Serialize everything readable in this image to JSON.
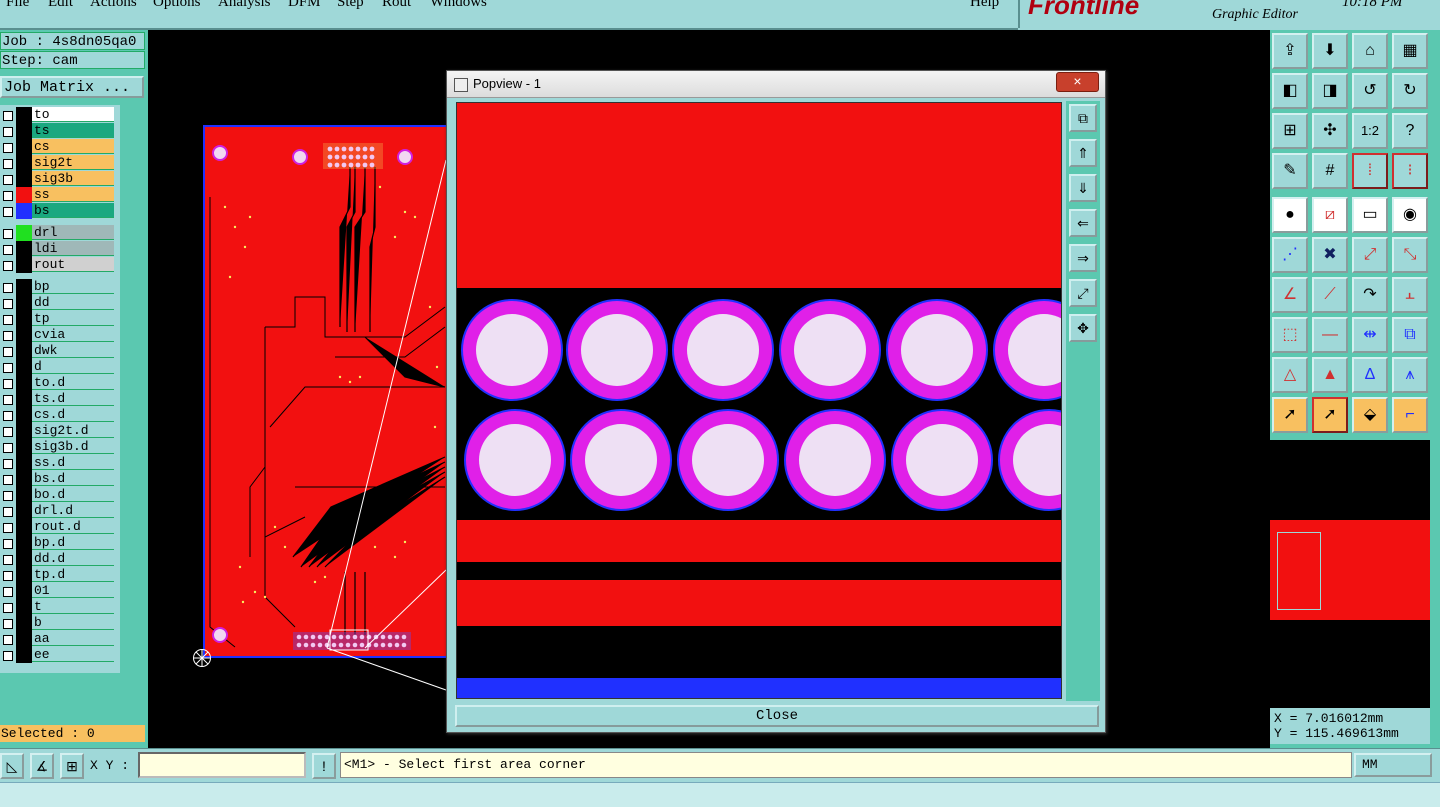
{
  "menu": {
    "items": [
      "File",
      "Edit",
      "Actions",
      "Options",
      "Analysis",
      "DFM",
      "Step",
      "Rout",
      "Windows"
    ],
    "help": "Help"
  },
  "brand": {
    "logo": "Frontline",
    "subtitle": "Graphic Editor",
    "clock": "10:18 PM"
  },
  "job": {
    "job_label": "Job : 4s8dn05qa0",
    "step_label": "Step: cam",
    "matrix_button": "Job Matrix ..."
  },
  "layers": [
    {
      "name": "to",
      "color": "#ffffff",
      "swatch": "#000000"
    },
    {
      "name": "ts",
      "color": "#1aa880",
      "swatch": "#000000"
    },
    {
      "name": "cs",
      "color": "#f8c060",
      "swatch": "#000000"
    },
    {
      "name": "sig2t",
      "color": "#f8c060",
      "swatch": "#000000"
    },
    {
      "name": "sig3b",
      "color": "#f8c060",
      "swatch": "#000000"
    },
    {
      "name": "ss",
      "color": "#f8c060",
      "swatch": "#f21010"
    },
    {
      "name": "bs",
      "color": "#1aa880",
      "swatch": "#2030ff"
    },
    {
      "name": "drl",
      "color": "#9fb8b8",
      "swatch": "#20e020"
    },
    {
      "name": "ldi",
      "color": "#9fb8b8",
      "swatch": "#000000"
    },
    {
      "name": "rout",
      "color": "#d0d0d0",
      "swatch": "#000000"
    },
    {
      "name": "bp",
      "color": "#9fd8d8",
      "swatch": "#000000"
    },
    {
      "name": "dd",
      "color": "#9fd8d8",
      "swatch": "#000000"
    },
    {
      "name": "tp",
      "color": "#9fd8d8",
      "swatch": "#000000"
    },
    {
      "name": "cvia",
      "color": "#9fd8d8",
      "swatch": "#000000"
    },
    {
      "name": "dwk",
      "color": "#9fd8d8",
      "swatch": "#000000"
    },
    {
      "name": "d",
      "color": "#9fd8d8",
      "swatch": "#000000"
    },
    {
      "name": "to.d",
      "color": "#9fd8d8",
      "swatch": "#000000"
    },
    {
      "name": "ts.d",
      "color": "#9fd8d8",
      "swatch": "#000000"
    },
    {
      "name": "cs.d",
      "color": "#9fd8d8",
      "swatch": "#000000"
    },
    {
      "name": "sig2t.d",
      "color": "#9fd8d8",
      "swatch": "#000000"
    },
    {
      "name": "sig3b.d",
      "color": "#9fd8d8",
      "swatch": "#000000"
    },
    {
      "name": "ss.d",
      "color": "#9fd8d8",
      "swatch": "#000000"
    },
    {
      "name": "bs.d",
      "color": "#9fd8d8",
      "swatch": "#000000"
    },
    {
      "name": "bo.d",
      "color": "#9fd8d8",
      "swatch": "#000000"
    },
    {
      "name": "drl.d",
      "color": "#9fd8d8",
      "swatch": "#000000"
    },
    {
      "name": "rout.d",
      "color": "#9fd8d8",
      "swatch": "#000000"
    },
    {
      "name": "bp.d",
      "color": "#9fd8d8",
      "swatch": "#000000"
    },
    {
      "name": "dd.d",
      "color": "#9fd8d8",
      "swatch": "#000000"
    },
    {
      "name": "tp.d",
      "color": "#9fd8d8",
      "swatch": "#000000"
    },
    {
      "name": "01",
      "color": "#9fd8d8",
      "swatch": "#000000"
    },
    {
      "name": "t",
      "color": "#9fd8d8",
      "swatch": "#000000"
    },
    {
      "name": "b",
      "color": "#9fd8d8",
      "swatch": "#000000"
    },
    {
      "name": "aa",
      "color": "#9fd8d8",
      "swatch": "#000000"
    },
    {
      "name": "ee",
      "color": "#9fd8d8",
      "swatch": "#000000"
    }
  ],
  "selected_label": "Selected : 0",
  "popup": {
    "title": "Popview - 1",
    "close_label": "Close",
    "close_glyph": "×"
  },
  "coords": {
    "x": "X = 7.016012mm",
    "y": "Y = 115.469613mm"
  },
  "bottom": {
    "xy_label": "X Y :",
    "xy_value": "",
    "message": "<M1> - Select first area corner",
    "unit": "MM"
  },
  "colors": {
    "copper": "#f21010",
    "pad_ring": "#e020e8",
    "pad_center": "#eee0f4",
    "outline": "#2030ff",
    "panel": "#9fd8d8",
    "panel_dark": "#5bc8b0"
  }
}
